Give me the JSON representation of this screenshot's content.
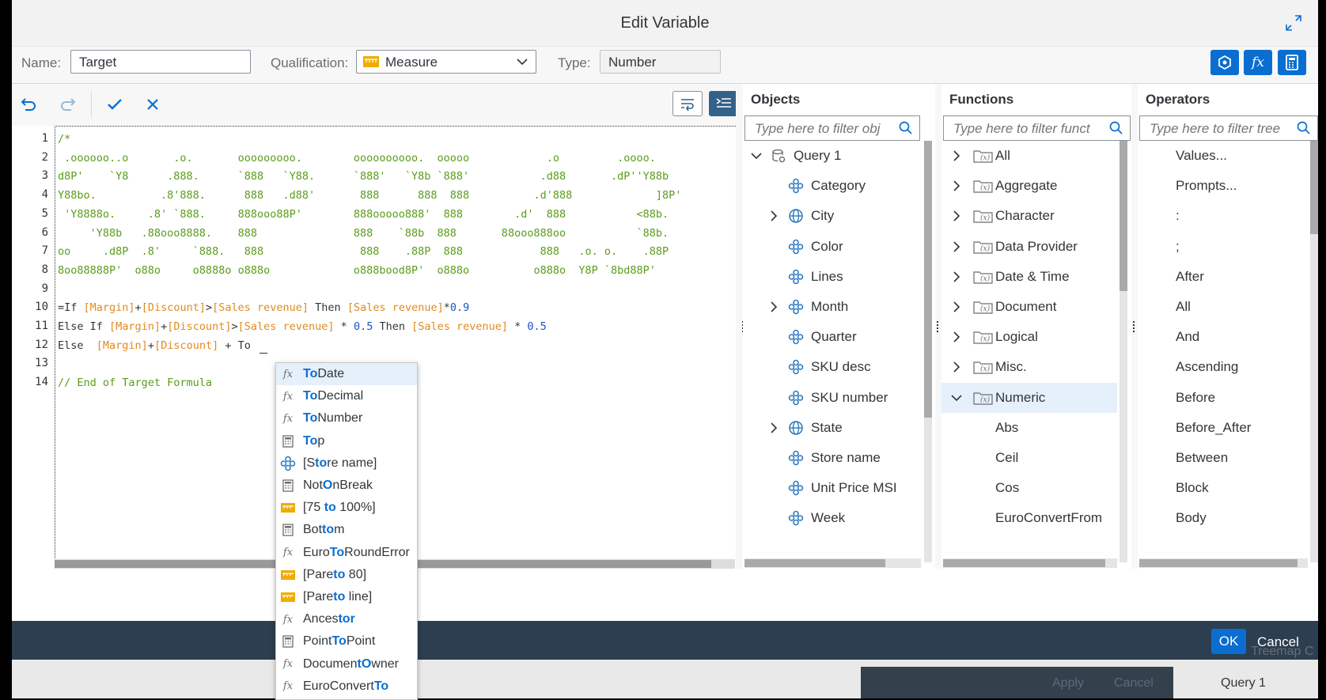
{
  "dialog": {
    "title": "Edit Variable"
  },
  "props": {
    "name_label": "Name:",
    "name_value": "Target",
    "qualification_label": "Qualification:",
    "qualification_value": "Measure",
    "type_label": "Type:",
    "type_value": "Number"
  },
  "editor": {
    "lines": [
      {
        "n": "1",
        "parts": [
          {
            "t": "/*",
            "c": "cm"
          }
        ]
      },
      {
        "n": "2",
        "parts": [
          {
            "t": " .oooooo..o       .o.       ooooooooo.        oooooooooo.  ooooo            .o         .oooo.",
            "c": "cm"
          }
        ]
      },
      {
        "n": "3",
        "parts": [
          {
            "t": "d8P'    `Y8      .888.      `888   `Y88.      `888'   `Y8b `888'           .d88       .dP''Y88b",
            "c": "cm"
          }
        ]
      },
      {
        "n": "4",
        "parts": [
          {
            "t": "Y88bo.          .8'888.      888   .d88'       888      888  888          .d'888             ]8P'",
            "c": "cm"
          }
        ]
      },
      {
        "n": "5",
        "parts": [
          {
            "t": " 'Y8888o.     .8' `888.     888ooo88P'        888ooooo888'  888        .d'  888           <88b.",
            "c": "cm"
          }
        ]
      },
      {
        "n": "6",
        "parts": [
          {
            "t": "     'Y88b   .88ooo8888.    888               888    `88b  888       88ooo888oo           `88b.",
            "c": "cm"
          }
        ]
      },
      {
        "n": "7",
        "parts": [
          {
            "t": "oo     .d8P  .8'     `888.   888               888    .88P  888            888   .o. o.    .88P",
            "c": "cm"
          }
        ]
      },
      {
        "n": "8",
        "parts": [
          {
            "t": "8oo88888P'  o88o     o8888o o888o             o888bood8P'  o888o          o888o  Y8P `8bd88P'",
            "c": "cm"
          }
        ]
      },
      {
        "n": "9",
        "parts": []
      },
      {
        "n": "10",
        "parts": [
          {
            "t": "=If ",
            "c": ""
          },
          {
            "t": "[Margin]",
            "c": "fld"
          },
          {
            "t": "+",
            "c": ""
          },
          {
            "t": "[Discount]",
            "c": "fld"
          },
          {
            "t": ">",
            "c": ""
          },
          {
            "t": "[Sales revenue]",
            "c": "fld"
          },
          {
            "t": " Then ",
            "c": ""
          },
          {
            "t": "[Sales revenue]",
            "c": "fld"
          },
          {
            "t": "*",
            "c": ""
          },
          {
            "t": "0.9",
            "c": "num"
          }
        ]
      },
      {
        "n": "11",
        "parts": [
          {
            "t": "Else If ",
            "c": ""
          },
          {
            "t": "[Margin]",
            "c": "fld"
          },
          {
            "t": "+",
            "c": ""
          },
          {
            "t": "[Discount]",
            "c": "fld"
          },
          {
            "t": ">",
            "c": ""
          },
          {
            "t": "[Sales revenue]",
            "c": "fld"
          },
          {
            "t": " * ",
            "c": ""
          },
          {
            "t": "0.5",
            "c": "num"
          },
          {
            "t": " Then ",
            "c": ""
          },
          {
            "t": "[Sales revenue]",
            "c": "fld"
          },
          {
            "t": " * ",
            "c": ""
          },
          {
            "t": "0.5",
            "c": "num"
          }
        ]
      },
      {
        "n": "12",
        "parts": [
          {
            "t": "Else  ",
            "c": ""
          },
          {
            "t": "[Margin]",
            "c": "fld"
          },
          {
            "t": "+",
            "c": ""
          },
          {
            "t": "[Discount]",
            "c": "fld"
          },
          {
            "t": " + To",
            "c": ""
          }
        ]
      },
      {
        "n": "13",
        "parts": []
      },
      {
        "n": "14",
        "parts": [
          {
            "t": "// End of Target Formula",
            "c": "cm"
          }
        ]
      }
    ]
  },
  "objects": {
    "header": "Objects",
    "filter_placeholder": "Type here to filter obj",
    "items": [
      {
        "label": "Query 1",
        "indent": 0,
        "chev": "down",
        "icon": "query"
      },
      {
        "label": "Category",
        "indent": 1,
        "chev": "",
        "icon": "dim"
      },
      {
        "label": "City",
        "indent": 1,
        "chev": "right",
        "icon": "geo"
      },
      {
        "label": "Color",
        "indent": 1,
        "chev": "",
        "icon": "dim"
      },
      {
        "label": "Lines",
        "indent": 1,
        "chev": "",
        "icon": "dim"
      },
      {
        "label": "Month",
        "indent": 1,
        "chev": "right",
        "icon": "dim"
      },
      {
        "label": "Quarter",
        "indent": 1,
        "chev": "",
        "icon": "dim"
      },
      {
        "label": "SKU desc",
        "indent": 1,
        "chev": "",
        "icon": "dim"
      },
      {
        "label": "SKU number",
        "indent": 1,
        "chev": "",
        "icon": "dim"
      },
      {
        "label": "State",
        "indent": 1,
        "chev": "right",
        "icon": "geo"
      },
      {
        "label": "Store name",
        "indent": 1,
        "chev": "",
        "icon": "dim"
      },
      {
        "label": "Unit Price MSI",
        "indent": 1,
        "chev": "",
        "icon": "dim"
      },
      {
        "label": "Week",
        "indent": 1,
        "chev": "",
        "icon": "dim"
      }
    ]
  },
  "functions": {
    "header": "Functions",
    "filter_placeholder": "Type here to filter funct",
    "items": [
      {
        "label": "All",
        "chev": "right",
        "icon": "folder"
      },
      {
        "label": "Aggregate",
        "chev": "right",
        "icon": "folder"
      },
      {
        "label": "Character",
        "chev": "right",
        "icon": "folder"
      },
      {
        "label": "Data Provider",
        "chev": "right",
        "icon": "folder"
      },
      {
        "label": "Date & Time",
        "chev": "right",
        "icon": "folder"
      },
      {
        "label": "Document",
        "chev": "right",
        "icon": "folder"
      },
      {
        "label": "Logical",
        "chev": "right",
        "icon": "folder"
      },
      {
        "label": "Misc.",
        "chev": "right",
        "icon": "folder"
      },
      {
        "label": "Numeric",
        "chev": "down",
        "icon": "folder",
        "selected": true
      },
      {
        "label": "Abs",
        "chev": "",
        "icon": ""
      },
      {
        "label": "Ceil",
        "chev": "",
        "icon": ""
      },
      {
        "label": "Cos",
        "chev": "",
        "icon": ""
      },
      {
        "label": "EuroConvertFrom",
        "chev": "",
        "icon": ""
      }
    ]
  },
  "operators": {
    "header": "Operators",
    "filter_placeholder": "Type here to filter tree",
    "items": [
      "Values...",
      "Prompts...",
      ":",
      ";",
      "After",
      "All",
      "And",
      "Ascending",
      "Before",
      "Before_After",
      "Between",
      "Block",
      "Body"
    ]
  },
  "autocomplete": {
    "items": [
      {
        "icon": "fx",
        "pre": "",
        "match": "To",
        "post": "Date",
        "selected": true
      },
      {
        "icon": "fx",
        "pre": "",
        "match": "To",
        "post": "Decimal"
      },
      {
        "icon": "fx",
        "pre": "",
        "match": "To",
        "post": "Number"
      },
      {
        "icon": "calc",
        "pre": "",
        "match": "To",
        "post": "p"
      },
      {
        "icon": "dim",
        "pre": "[S",
        "match": "to",
        "post": "re name]"
      },
      {
        "icon": "calc",
        "pre": "Not",
        "match": "O",
        "post": "nBreak"
      },
      {
        "icon": "measure",
        "pre": "[75 ",
        "match": "to",
        "post": " 100%]"
      },
      {
        "icon": "calc",
        "pre": "Bot",
        "match": "to",
        "post": "m"
      },
      {
        "icon": "fx",
        "pre": "Euro",
        "match": "To",
        "post": "RoundError"
      },
      {
        "icon": "measure",
        "pre": "[Pare",
        "match": "to",
        "post": " 80]"
      },
      {
        "icon": "measure",
        "pre": "[Pare",
        "match": "to",
        "post": " line]"
      },
      {
        "icon": "fx",
        "pre": "Ances",
        "match": "tor",
        "post": ""
      },
      {
        "icon": "calc",
        "pre": "Point",
        "match": "To",
        "post": "Point"
      },
      {
        "icon": "fx",
        "pre": "Documen",
        "match": "tO",
        "post": "wner"
      },
      {
        "icon": "fx",
        "pre": "EuroConvert",
        "match": "To",
        "post": ""
      }
    ]
  },
  "footer": {
    "ok": "OK",
    "cancel": "Cancel"
  },
  "background": {
    "apply": "Apply",
    "cancel": "Cancel",
    "tree_item": "Query 1",
    "tree_item_partial": "Treemap C"
  }
}
